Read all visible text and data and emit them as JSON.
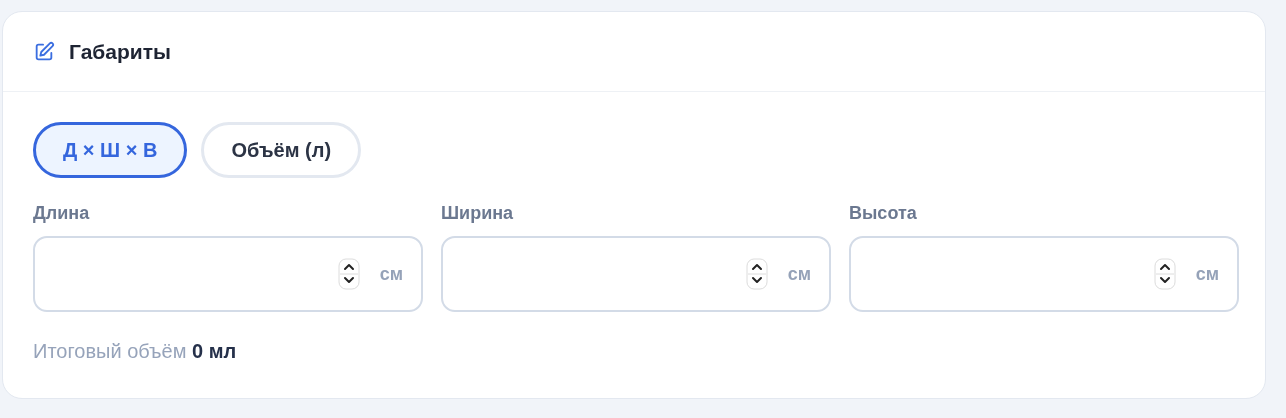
{
  "card": {
    "title": "Габариты"
  },
  "modes": [
    {
      "label": "Д × Ш × В",
      "selected": true
    },
    {
      "label": "Объём (л)",
      "selected": false
    }
  ],
  "fields": [
    {
      "label": "Длина",
      "unit": "см"
    },
    {
      "label": "Ширина",
      "unit": "см"
    },
    {
      "label": "Высота",
      "unit": "см"
    }
  ],
  "total": "Итоговый объём **0 мл**"
}
